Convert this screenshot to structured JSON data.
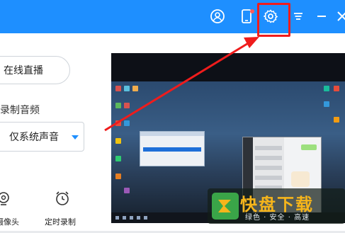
{
  "window": {
    "title_icons": [
      "user-icon",
      "phone-icon",
      "settings-icon",
      "menu-icon",
      "minimize-icon",
      "close-icon"
    ],
    "accent_color": "#1e8fff",
    "highlight_color": "#ef1c1c"
  },
  "sidebar": {
    "live_button": "在线直播",
    "audio_label": "录制音频",
    "audio_select": {
      "selected": "仅系统声音"
    },
    "tools": [
      {
        "label": "摄像头",
        "icon": "webcam-icon"
      },
      {
        "label": "定时录制",
        "icon": "alarm-clock-icon"
      }
    ]
  },
  "preview": {
    "description": "screen-capture-preview"
  },
  "watermark": {
    "brand": "快盘下载",
    "slogan": "绿色 · 安全 · 高速"
  }
}
